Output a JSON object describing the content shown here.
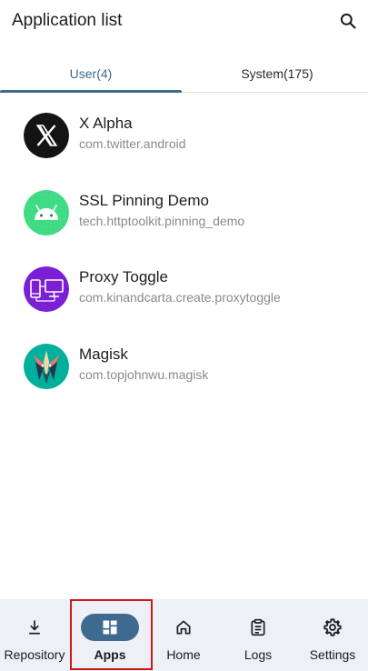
{
  "header": {
    "title": "Application list",
    "search_icon": "search-icon"
  },
  "tabs": [
    {
      "label": "User(4)",
      "selected": true
    },
    {
      "label": "System(175)",
      "selected": false
    }
  ],
  "apps": [
    {
      "name": "X Alpha",
      "package": "com.twitter.android",
      "icon": "x-logo-icon"
    },
    {
      "name": "SSL Pinning Demo",
      "package": "tech.httptoolkit.pinning_demo",
      "icon": "android-icon"
    },
    {
      "name": "Proxy Toggle",
      "package": "com.kinandcarta.create.proxytoggle",
      "icon": "proxy-toggle-icon"
    },
    {
      "name": "Magisk",
      "package": "com.topjohnwu.magisk",
      "icon": "magisk-icon"
    }
  ],
  "bottom_nav": [
    {
      "label": "Repository",
      "icon": "download-icon",
      "selected": false
    },
    {
      "label": "Apps",
      "icon": "apps-grid-icon",
      "selected": true
    },
    {
      "label": "Home",
      "icon": "home-icon",
      "selected": false
    },
    {
      "label": "Logs",
      "icon": "clipboard-icon",
      "selected": false
    },
    {
      "label": "Settings",
      "icon": "gear-icon",
      "selected": false
    }
  ],
  "colors": {
    "accent": "#3d6a8e",
    "nav_background": "#edf0f6",
    "highlight": "#cc1a1a"
  }
}
